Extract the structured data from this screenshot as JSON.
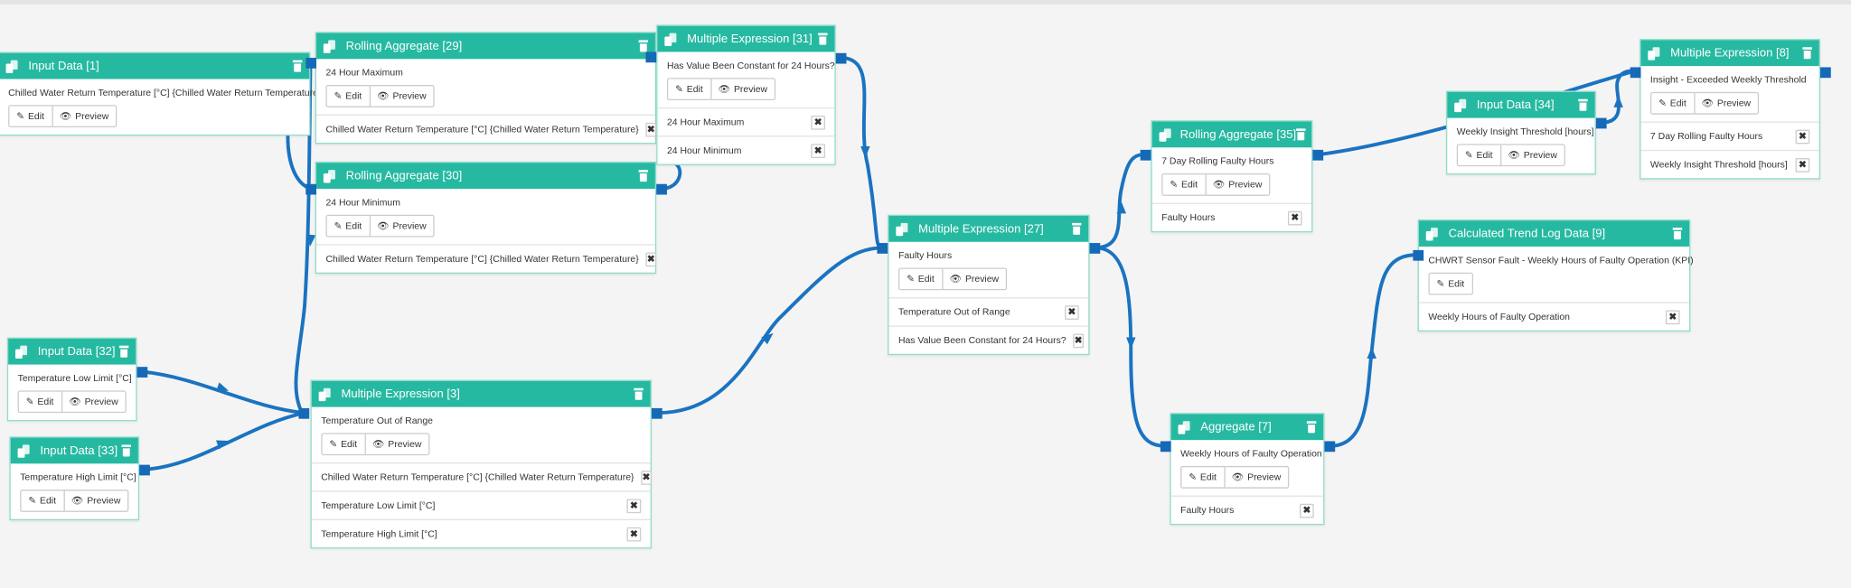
{
  "colors": {
    "header": "#26b9a1",
    "wire": "#1a73c0",
    "port": "#1569b7"
  },
  "icons": {
    "node": "copy-icon",
    "delete": "trash-icon",
    "edit": "pencil-icon",
    "preview": "eye-icon",
    "remove": "close-icon"
  },
  "labels": {
    "edit": "Edit",
    "preview": "Preview",
    "remove": "✖"
  },
  "nodes": [
    {
      "id": "n1",
      "title": "Input Data [1]",
      "description": "Chilled Water Return Temperature [°C] {Chilled Water Return Temperature}",
      "preview": true,
      "inputs": []
    },
    {
      "id": "n29",
      "title": "Rolling Aggregate [29]",
      "description": "24 Hour Maximum",
      "preview": true,
      "inputs": [
        "Chilled Water Return Temperature [°C] {Chilled Water Return Temperature}"
      ]
    },
    {
      "id": "n30",
      "title": "Rolling Aggregate [30]",
      "description": "24 Hour Minimum",
      "preview": true,
      "inputs": [
        "Chilled Water Return Temperature [°C] {Chilled Water Return Temperature}"
      ]
    },
    {
      "id": "n31",
      "title": "Multiple Expression [31]",
      "description": "Has Value Been Constant for 24 Hours?",
      "preview": true,
      "inputs": [
        "24 Hour Maximum",
        "24 Hour Minimum"
      ]
    },
    {
      "id": "n32",
      "title": "Input Data [32]",
      "description": "Temperature Low Limit [°C]",
      "preview": true,
      "inputs": []
    },
    {
      "id": "n33",
      "title": "Input Data [33]",
      "description": "Temperature High Limit [°C]",
      "preview": true,
      "inputs": []
    },
    {
      "id": "n3",
      "title": "Multiple Expression [3]",
      "description": "Temperature Out of Range",
      "preview": true,
      "inputs": [
        "Chilled Water Return Temperature [°C] {Chilled Water Return Temperature}",
        "Temperature Low Limit [°C]",
        "Temperature High Limit [°C]"
      ]
    },
    {
      "id": "n27",
      "title": "Multiple Expression [27]",
      "description": "Faulty Hours",
      "preview": true,
      "inputs": [
        "Temperature Out of Range",
        "Has Value Been Constant for 24 Hours?"
      ]
    },
    {
      "id": "n35",
      "title": "Rolling Aggregate [35]",
      "description": "7 Day Rolling Faulty Hours",
      "preview": true,
      "inputs": [
        "Faulty Hours"
      ]
    },
    {
      "id": "n34",
      "title": "Input Data [34]",
      "description": "Weekly Insight Threshold [hours]",
      "preview": true,
      "inputs": []
    },
    {
      "id": "n8",
      "title": "Multiple Expression [8]",
      "description": "Insight - Exceeded Weekly Threshold",
      "preview": true,
      "inputs": [
        "7 Day Rolling Faulty Hours",
        "Weekly Insight Threshold [hours]"
      ]
    },
    {
      "id": "n9",
      "title": "Calculated Trend Log Data [9]",
      "description": "CHWRT Sensor Fault - Weekly Hours of Faulty Operation (KPI)",
      "preview": false,
      "inputs": [
        "Weekly Hours of Faulty Operation"
      ]
    },
    {
      "id": "n7",
      "title": "Aggregate [7]",
      "description": "Weekly Hours of Faulty Operation",
      "preview": true,
      "inputs": [
        "Faulty Hours"
      ]
    }
  ]
}
